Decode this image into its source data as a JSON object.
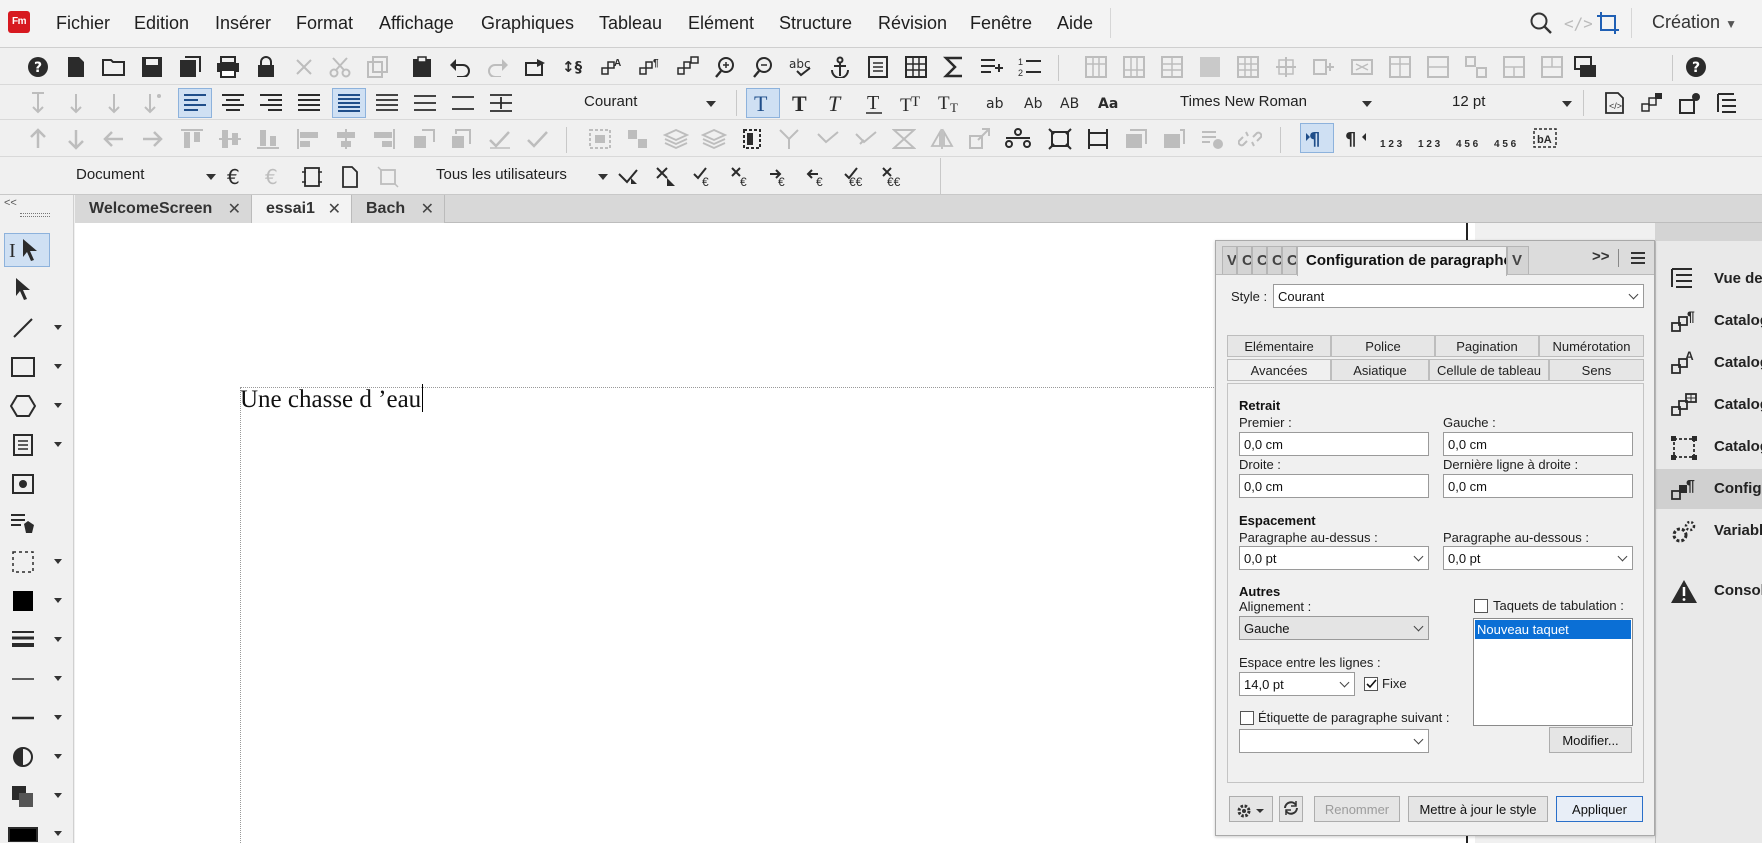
{
  "app": {
    "logo": "Fm"
  },
  "menu": [
    "Fichier",
    "Edition",
    "Insérer",
    "Format",
    "Affichage",
    "Graphiques",
    "Tableau",
    "Elément",
    "Structure",
    "Révision",
    "Fenêtre",
    "Aide"
  ],
  "workspace": {
    "label": "Création"
  },
  "toolbar_format": {
    "style": "Courant",
    "font": "Times New Roman",
    "size": "12 pt"
  },
  "toolbar_track": {
    "view": "Document",
    "users": "Tous les utilisateurs"
  },
  "doc_tabs": [
    {
      "label": "WelcomeScreen"
    },
    {
      "label": "essai1"
    },
    {
      "label": "Bach"
    }
  ],
  "document": {
    "text": "Une chasse d ’eau"
  },
  "right_pod": {
    "items": [
      {
        "label": "Vue de",
        "icon": "structure-view-icon"
      },
      {
        "label": "Catalog",
        "icon": "paragraph-catalog-icon"
      },
      {
        "label": "Catalog",
        "icon": "character-catalog-icon"
      },
      {
        "label": "Catalog",
        "icon": "table-catalog-icon"
      },
      {
        "label": "Catalog",
        "icon": "object-catalog-icon"
      },
      {
        "label": "Configu",
        "icon": "paragraph-designer-icon"
      },
      {
        "label": "Variabl",
        "icon": "variables-icon"
      },
      {
        "label": "Consol",
        "icon": "warning-icon"
      }
    ]
  },
  "para_designer": {
    "collapsed_tabs": [
      "V",
      "C",
      "C",
      "C",
      "C"
    ],
    "active_tab": "Configuration de paragraphes",
    "trailing_tab": "V",
    "more": ">>",
    "style_label": "Style :",
    "style_value": "Courant",
    "subtabs_row1": [
      "Elémentaire",
      "Police",
      "Pagination",
      "Numérotation"
    ],
    "subtabs_row2": [
      "Avancées",
      "Asiatique",
      "Cellule de tableau",
      "Sens"
    ],
    "retrait": {
      "header": "Retrait",
      "premier_label": "Premier :",
      "premier_value": "0,0 cm",
      "gauche_label": "Gauche :",
      "gauche_value": "0,0 cm",
      "droite_label": "Droite :",
      "droite_value": "0,0 cm",
      "derniere_label": "Dernière ligne à droite :",
      "derniere_value": "0,0 cm"
    },
    "espacement": {
      "header": "Espacement",
      "dessus_label": "Paragraphe au-dessus :",
      "dessus_value": "0,0 pt",
      "dessous_label": "Paragraphe au-dessous :",
      "dessous_value": "0,0 pt"
    },
    "autres": {
      "header": "Autres",
      "alignement_label": "Alignement :",
      "alignement_value": "Gauche",
      "interligne_label": "Espace entre les lignes :",
      "interligne_value": "14,0 pt",
      "fixe_label": "Fixe",
      "fixe_checked": true,
      "etiquette_label": "Étiquette de paragraphe suivant :",
      "etiquette_value": "",
      "taquets_label": "Taquets de tabulation :",
      "taquets_items": [
        "Nouveau taquet"
      ],
      "modifier_label": "Modifier..."
    },
    "footer": {
      "renommer": "Renommer",
      "maj": "Mettre à jour le style",
      "appliquer": "Appliquer"
    }
  }
}
